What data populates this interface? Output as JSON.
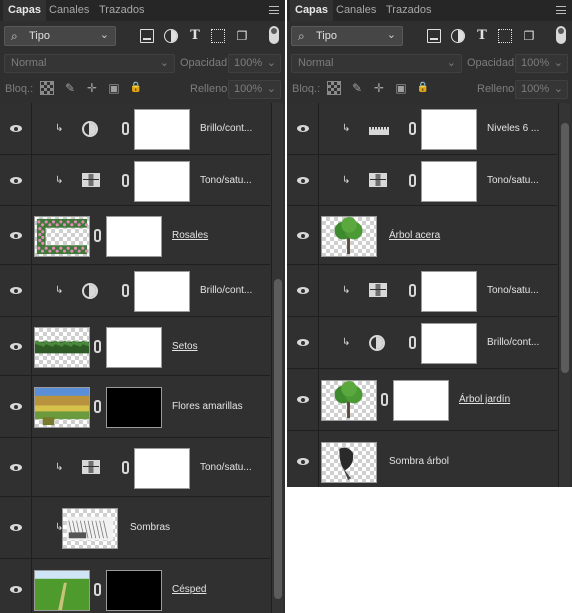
{
  "panels": [
    {
      "tabs": [
        "Capas",
        "Canales",
        "Trazados"
      ],
      "active_tab": 0,
      "filter": {
        "kind_label": "Tipo"
      },
      "blend_mode": "Normal",
      "opacity_label": "Opacidad:",
      "opacity_value": "100%",
      "lock_label": "Bloq.:",
      "fill_label": "Relleno:",
      "fill_value": "100%",
      "layers": [
        {
          "name": "Brillo/cont...",
          "type": "adjustment",
          "adjustment": "brightness-contrast",
          "clipped": true,
          "linked": false
        },
        {
          "name": "Tono/satu...",
          "type": "adjustment",
          "adjustment": "hue-saturation",
          "clipped": true,
          "linked": false
        },
        {
          "name": "Rosales",
          "type": "image",
          "image": "rosales",
          "mask": "white",
          "clipped": false,
          "linked": true
        },
        {
          "name": "Brillo/cont...",
          "type": "adjustment",
          "adjustment": "brightness-contrast",
          "clipped": true,
          "linked": false
        },
        {
          "name": "Setos",
          "type": "image",
          "image": "setos",
          "mask": "white",
          "clipped": false,
          "linked": true
        },
        {
          "name": "Flores amarillas",
          "type": "image",
          "image": "flores",
          "mask": "black",
          "clipped": false,
          "linked": false
        },
        {
          "name": "Tono/satu...",
          "type": "adjustment",
          "adjustment": "hue-saturation",
          "clipped": true,
          "linked": false
        },
        {
          "name": "Sombras",
          "type": "image",
          "image": "sombras",
          "mask": "none",
          "clipped": true,
          "linked": false
        },
        {
          "name": "Césped",
          "type": "image",
          "image": "cesped",
          "mask": "black",
          "clipped": false,
          "linked": true
        }
      ]
    },
    {
      "tabs": [
        "Capas",
        "Canales",
        "Trazados"
      ],
      "active_tab": 0,
      "filter": {
        "kind_label": "Tipo"
      },
      "blend_mode": "Normal",
      "opacity_label": "Opacidad:",
      "opacity_value": "100%",
      "lock_label": "Bloq.:",
      "fill_label": "Relleno:",
      "fill_value": "100%",
      "layers": [
        {
          "name": "Niveles 6 ...",
          "type": "adjustment",
          "adjustment": "levels",
          "clipped": true,
          "linked": false
        },
        {
          "name": "Tono/satu...",
          "type": "adjustment",
          "adjustment": "hue-saturation",
          "clipped": true,
          "linked": false
        },
        {
          "name": "Árbol acera",
          "type": "image",
          "image": "arbol-acera",
          "mask": "none",
          "clipped": false,
          "linked": true
        },
        {
          "name": "Tono/satu...",
          "type": "adjustment",
          "adjustment": "hue-saturation",
          "clipped": true,
          "linked": false
        },
        {
          "name": "Brillo/cont...",
          "type": "adjustment",
          "adjustment": "brightness-contrast",
          "clipped": true,
          "linked": false
        },
        {
          "name": "Árbol jardín",
          "type": "image",
          "image": "arbol-jardin",
          "mask": "white",
          "clipped": false,
          "linked": true
        },
        {
          "name": "Sombra árbol",
          "type": "image",
          "image": "sombra-arbol",
          "mask": "none",
          "clipped": false,
          "linked": false
        }
      ]
    }
  ],
  "colors": {
    "panel_bg": "#2f2f2f",
    "row_bg": "#303030",
    "tab_bar": "#262626",
    "text": "#e3e3e3",
    "muted": "#7d7d7d"
  }
}
